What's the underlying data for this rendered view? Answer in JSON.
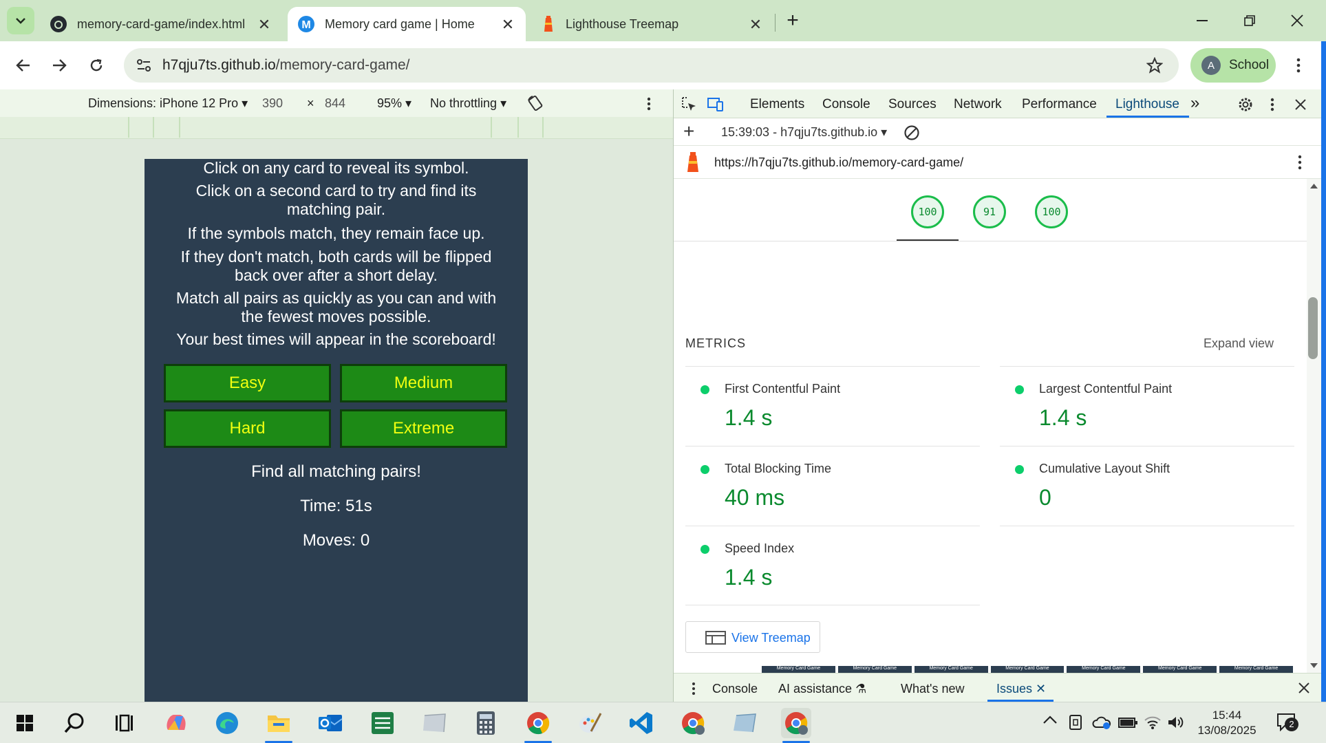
{
  "browser": {
    "tabs": [
      {
        "title": "memory-card-game/index.html",
        "icon": "github-icon",
        "active": false
      },
      {
        "title": "Memory card game | Home",
        "icon": "m-logo-icon",
        "active": true
      },
      {
        "title": "Lighthouse Treemap",
        "icon": "lighthouse-icon",
        "active": false
      }
    ],
    "url_host": "h7qju7ts.github.io",
    "url_path": "/memory-card-game/",
    "profile_initial": "A",
    "profile_name": "School"
  },
  "device_toolbar": {
    "dimensions_label": "Dimensions: iPhone 12 Pro",
    "width": "390",
    "times": "×",
    "height": "844",
    "zoom": "95%",
    "throttling": "No throttling"
  },
  "game": {
    "instructions": [
      "Click on any card to reveal its symbol.",
      "Click on a second card to try and find its matching pair.",
      "If the symbols match, they remain face up.",
      "If they don't match, both cards will be flipped back over after a short delay.",
      "Match all pairs as quickly as you can and with the fewest moves possible.",
      "Your best times will appear in the scoreboard!"
    ],
    "difficulty_buttons": [
      "Easy",
      "Medium",
      "Hard",
      "Extreme"
    ],
    "status": "Find all matching pairs!",
    "time": "Time: 51s",
    "moves": "Moves: 0"
  },
  "devtools": {
    "tabs": [
      "Elements",
      "Console",
      "Sources",
      "Network",
      "Performance",
      "Lighthouse"
    ],
    "selected_tab": "Lighthouse",
    "more_tabs": "»",
    "report_selector": "15:39:03 - h7qju7ts.github.io",
    "report_url": "https://h7qju7ts.github.io/memory-card-game/",
    "scores": [
      "100",
      "91",
      "100"
    ],
    "metrics_heading": "METRICS",
    "expand_view": "Expand view",
    "metrics": [
      {
        "label": "First Contentful Paint",
        "value": "1.4 s"
      },
      {
        "label": "Largest Contentful Paint",
        "value": "1.4 s"
      },
      {
        "label": "Total Blocking Time",
        "value": "40 ms"
      },
      {
        "label": "Cumulative Layout Shift",
        "value": "0"
      },
      {
        "label": "Speed Index",
        "value": "1.4 s"
      }
    ],
    "view_treemap": "View Treemap",
    "filmstrip_label": "Memory Card Game",
    "drawer_tabs": [
      "Console",
      "AI assistance",
      "What's new",
      "Issues"
    ],
    "selected_drawer_tab": "Issues",
    "accent_color": "#0cce6b"
  },
  "taskbar": {
    "time": "15:44",
    "date": "13/08/2025",
    "notification_count": "2"
  }
}
